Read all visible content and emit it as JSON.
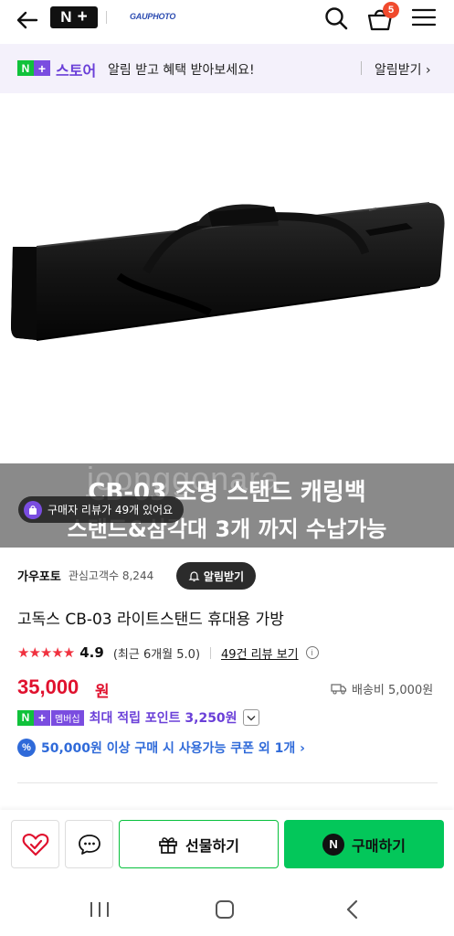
{
  "header": {
    "logo_n": "N",
    "logo_plus": "+",
    "brand": "GAUPHOTO",
    "cart_count": "5",
    "icons": [
      "back-arrow-icon",
      "search-icon",
      "cart-icon",
      "hamburger-menu-icon"
    ]
  },
  "notice": {
    "badge_n": "N",
    "badge_plus": "+",
    "store": "스토어",
    "message": "알림 받고 혜택 받아보세요!",
    "action": "알림받기 ›"
  },
  "banner": {
    "watermark": "joonggonara",
    "line1": "CB-03  조명 스탠드 캐링백",
    "line2": "스탠드&삼각대 3개 까지 수납가능",
    "review_pill": "구매자 리뷰가 49개 있어요"
  },
  "store": {
    "name": "가우포토",
    "followers": "관심고객수 8,244",
    "alarm_button": "알림받기"
  },
  "product": {
    "title": "고독스 CB-03 라이트스탠드 휴대용 가방",
    "stars": "★★★★★",
    "rating": "4.9",
    "recent_rating": "(최근 6개월 5.0)",
    "reviews_link": "49건 리뷰 보기",
    "price": "35,000",
    "price_unit": "원",
    "shipping": "배송비 5,000원"
  },
  "membership": {
    "n": "N",
    "plus": "+",
    "label": "멤버십",
    "points": "최대 적립 포인트 3,250원"
  },
  "coupon": {
    "icon": "%",
    "text": "50,000원 이상 구매 시 사용가능 쿠폰 외 1개 ›"
  },
  "bottom": {
    "gift": "선물하기",
    "buy_logo": "N",
    "buy": "구매하기"
  },
  "colors": {
    "naver_green": "#03c75a",
    "store_purple": "#6a3fd8",
    "price_red": "#e0112e",
    "coupon_blue": "#2f6ad9",
    "badge_orange": "#f04a2d"
  }
}
